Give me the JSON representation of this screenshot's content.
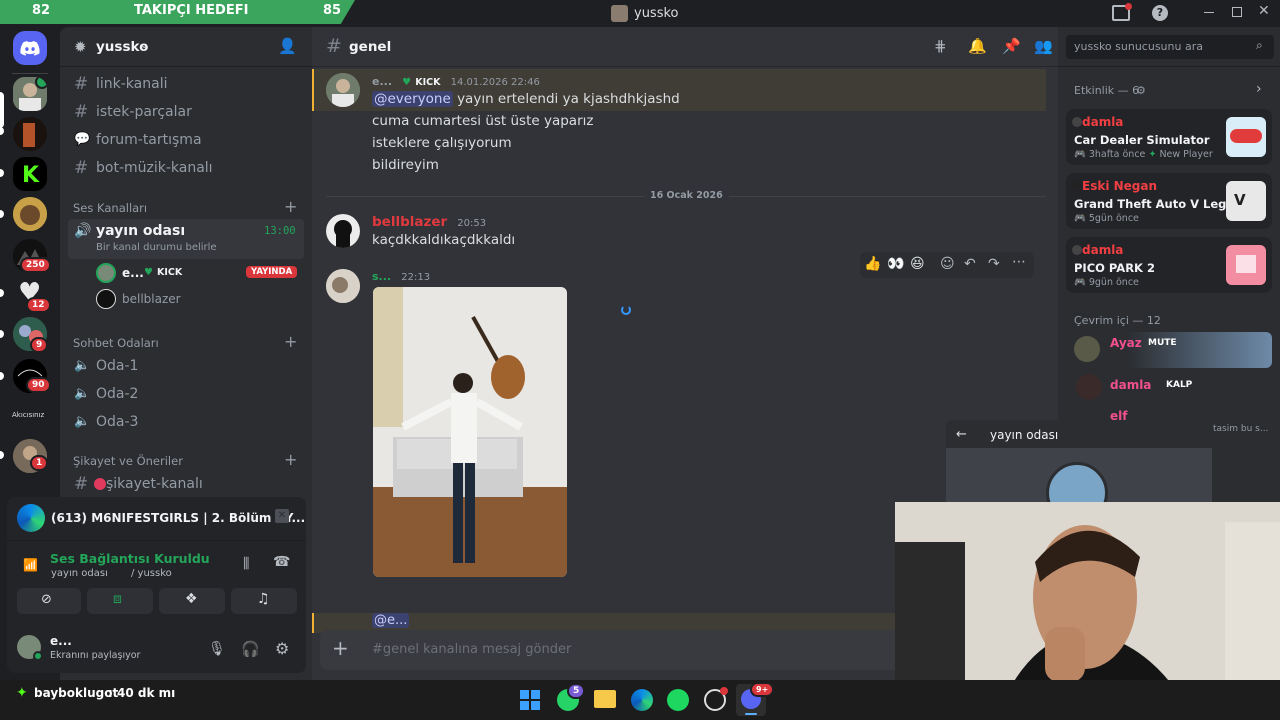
{
  "overlay": {
    "goal_start": "82",
    "goal_label": "TAKIPÇI HEDEFI",
    "goal_end": "85"
  },
  "window": {
    "title": "yussko"
  },
  "servers": {
    "badges": [
      "250",
      "12",
      "9",
      "90",
      "1"
    ],
    "text_server_label": "Akıcısınız"
  },
  "sidebar": {
    "server_name": "yussko",
    "channels_top": [
      {
        "icon": "hash",
        "label": "link-kanali"
      },
      {
        "icon": "hash",
        "label": "istek-parçalar"
      },
      {
        "icon": "forum",
        "label": "forum-tartışma"
      },
      {
        "icon": "hash",
        "label": "bot-müzik-kanalı"
      }
    ],
    "voice_category": "Ses Kanalları",
    "voice_channel": {
      "label": "yayın odası",
      "status": "Bir kanal durumu belirle",
      "time": "13:00"
    },
    "voice_users": [
      {
        "name": "e...",
        "tag": "KICK",
        "live": "YAYINDA"
      },
      {
        "name": "bellblazer"
      }
    ],
    "chat_category": "Sohbet Odaları",
    "chat_rooms": [
      "Oda-1",
      "Oda-2",
      "Oda-3"
    ],
    "complaint_category": "Şikayet ve Öneriler",
    "complaint_channel": "şikayet-kanalı"
  },
  "media_panel": {
    "title": "(613) M6NIFESTGIRLS | 2. Bölüm - Y...",
    "voice_status": "Ses Bağlantısı Kuruldu",
    "voice_location": "yayın odası",
    "voice_server": "/ yussko",
    "user_name": "e...",
    "user_status": "Ekranını paylaşıyor"
  },
  "chat": {
    "channel_name": "genel",
    "search_placeholder": "yussko sunucusunu ara",
    "messages": [
      {
        "author": "e...",
        "tag": "KICK",
        "time": "14.01.2026 22:46",
        "mention": "@everyone",
        "lines": [
          "yayın ertelendi ya kjashdhkjashd",
          "cuma cumartesi üst üste yaparız",
          "isteklere çalışıyorum",
          "bildireyim"
        ]
      },
      {
        "author": "bellblazer",
        "time": "20:53",
        "lines": [
          "kaçdkkaldıkaçdkkaldı"
        ]
      },
      {
        "author": "s...",
        "time": "22:13",
        "mention_bottom": "@e..."
      }
    ],
    "date_divider": "16 Ocak 2026",
    "input_placeholder": "#genel kanalına mesaj gönder"
  },
  "members": {
    "activity_header": "Etkinlik — 6",
    "activities": [
      {
        "user": "damla",
        "game": "Car Dealer Simulator",
        "meta": "3hafta önce",
        "extra": "New Player",
        "color": "#f23f43"
      },
      {
        "user": "Eski Negan",
        "game": "Grand Theft Auto V Legacy",
        "meta": "5gün önce",
        "color": "#f23f43"
      },
      {
        "user": "damla",
        "game": "PICO PARK 2",
        "meta": "9gün önce",
        "color": "#f23f43"
      }
    ],
    "online_header": "Çevrim içi — 12",
    "online": [
      {
        "name": "Ayaz",
        "tag": "MUTE",
        "color": "#f2508e"
      },
      {
        "name": "damla",
        "tag": "KALP",
        "color": "#f2508e"
      },
      {
        "name": "elf",
        "color": "#f2508e"
      }
    ],
    "stream_popup_title": "yayın odası",
    "stream_side_text": "tasim bu s..."
  },
  "taskbar": {
    "ticker_user": "bayboklugot",
    "ticker_text": ": 40 dk mı",
    "whatsapp_badge": "5",
    "discord_badge": "9+"
  },
  "colors": {
    "accent": "#5865f2",
    "green": "#3ba55d",
    "red": "#da373c",
    "mention_bg": "#3c4270"
  }
}
